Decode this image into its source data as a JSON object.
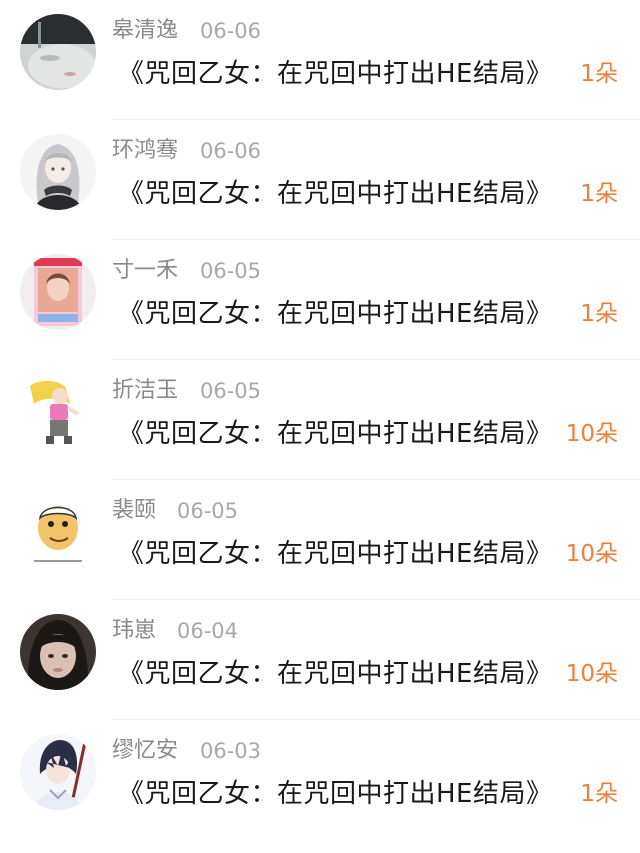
{
  "entries": [
    {
      "name": "皋清逸",
      "date": "06-06",
      "work": "《咒回乙女：在咒回中打出HE结局》",
      "gift": "1朵",
      "avatar": "avatar-photo-sleeping-face"
    },
    {
      "name": "环鸿骞",
      "date": "06-06",
      "work": "《咒回乙女：在咒回中打出HE结局》",
      "gift": "1朵",
      "avatar": "avatar-anime-girl-scarf"
    },
    {
      "name": "寸一禾",
      "date": "06-05",
      "work": "《咒回乙女：在咒回中打出HE结局》",
      "gift": "1朵",
      "avatar": "avatar-idol-photo-card"
    },
    {
      "name": "折洁玉",
      "date": "06-05",
      "work": "《咒回乙女：在咒回中打出HE结局》",
      "gift": "10朵",
      "avatar": "avatar-cartoon-blonde-girl"
    },
    {
      "name": "裴颐",
      "date": "06-05",
      "work": "《咒回乙女：在咒回中打出HE结局》",
      "gift": "10朵",
      "avatar": "avatar-cartoon-face-meme"
    },
    {
      "name": "玮崽",
      "date": "06-04",
      "work": "《咒回乙女：在咒回中打出HE结局》",
      "gift": "10朵",
      "avatar": "avatar-photo-dark-hair"
    },
    {
      "name": "缪忆安",
      "date": "06-03",
      "work": "《咒回乙女：在咒回中打出HE结局》",
      "gift": "1朵",
      "avatar": "avatar-anime-swordsman"
    }
  ],
  "colors": {
    "name": "#8a8a8a",
    "date": "#a8a8a8",
    "work": "#1a1a1a",
    "gift": "#e8823a"
  }
}
